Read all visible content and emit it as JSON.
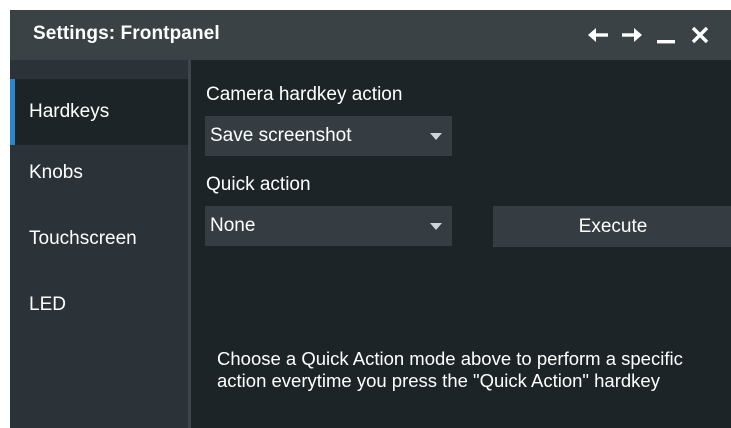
{
  "window": {
    "title": "Settings: Frontpanel",
    "icons": [
      "arrow-left-icon",
      "arrow-right-icon",
      "minimize-icon",
      "close-icon"
    ]
  },
  "sidebar": {
    "items": [
      {
        "label": "Hardkeys",
        "active": true
      },
      {
        "label": "Knobs",
        "active": false
      },
      {
        "label": "Touchscreen",
        "active": false
      },
      {
        "label": "LED",
        "active": false
      }
    ]
  },
  "main": {
    "camera": {
      "label": "Camera hardkey action",
      "value": "Save screenshot"
    },
    "quick_action": {
      "label": "Quick action",
      "value": "None"
    },
    "execute_label": "Execute",
    "help_text": "Choose a Quick Action mode above to perform a specific action everytime you press the \"Quick Action\" hardkey"
  },
  "colors": {
    "background": "#1d2427",
    "titlebar": "#3a4246",
    "sidebar": "#2b3338",
    "control": "#353d42",
    "accent": "#2a86c9"
  }
}
